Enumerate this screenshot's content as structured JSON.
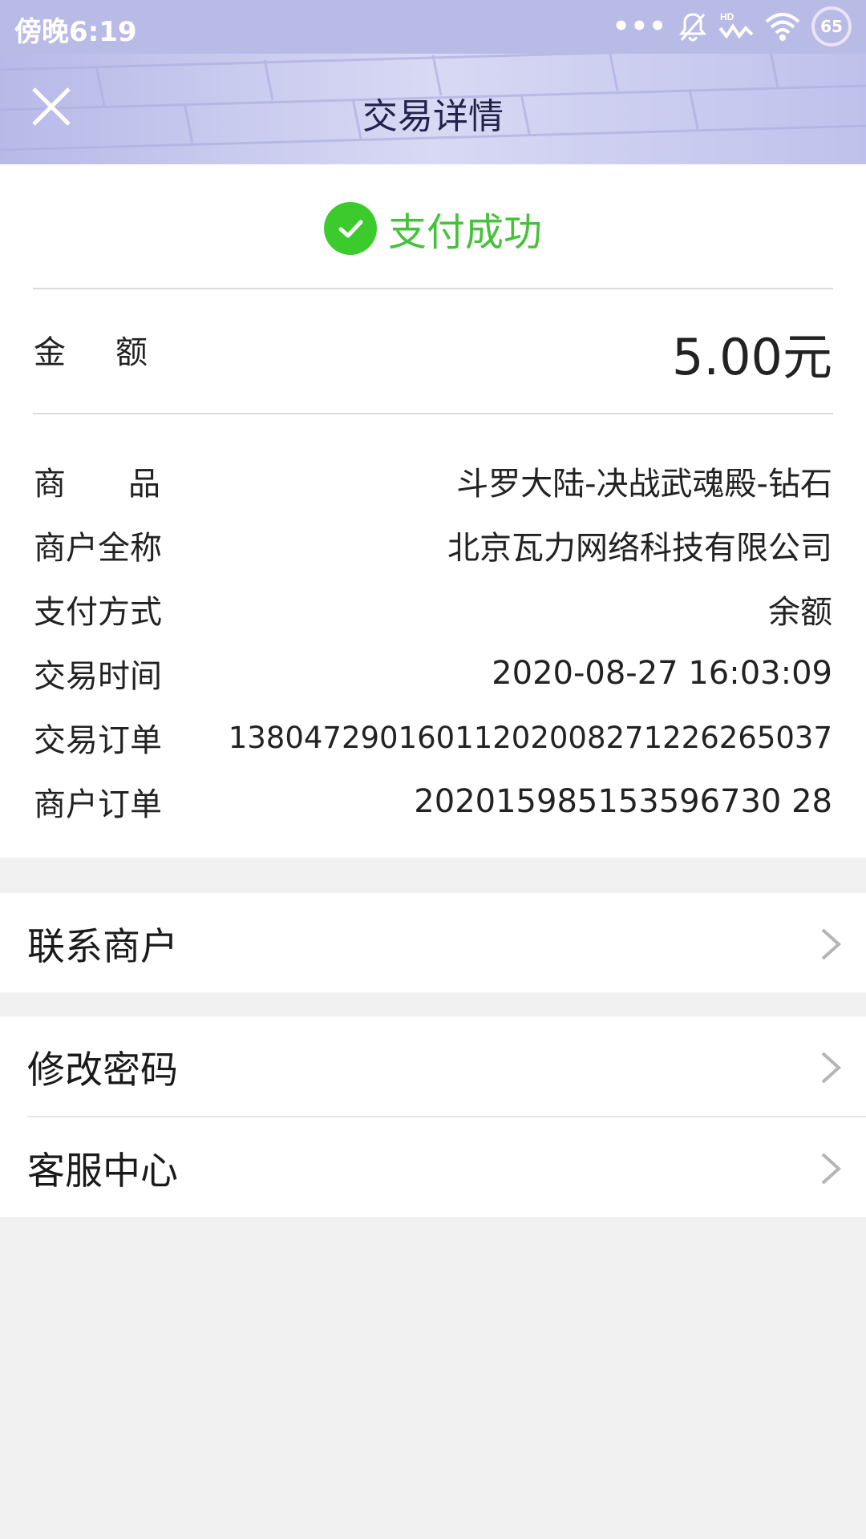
{
  "status_bar": {
    "time": "傍晚6:19",
    "dots": "•••",
    "battery": "65",
    "icons": [
      "bell-off-icon",
      "hd-signal-icon",
      "wifi-icon",
      "battery-icon"
    ]
  },
  "header": {
    "title": "交易详情",
    "close_icon": "close-icon"
  },
  "status": {
    "text": "支付成功",
    "icon": "check-circle-icon",
    "color": "#45c23a"
  },
  "amount": {
    "label": "金额",
    "value": "5.00元"
  },
  "details": [
    {
      "label": "商品",
      "value": "斗罗大陆-决战武魂殿-钻石"
    },
    {
      "label": "商户全称",
      "value": "北京瓦力网络科技有限公司"
    },
    {
      "label": "支付方式",
      "value": "余额"
    },
    {
      "label": "交易时间",
      "value": "2020-08-27 16:03:09"
    },
    {
      "label": "交易订单",
      "value": "13804729016011202008271226265037"
    },
    {
      "label": "商户订单",
      "value": "202015985153596730 28"
    }
  ],
  "menu_groups": [
    {
      "items": [
        {
          "label": "联系商户"
        }
      ]
    },
    {
      "items": [
        {
          "label": "修改密码"
        },
        {
          "label": "客服中心"
        }
      ]
    }
  ]
}
